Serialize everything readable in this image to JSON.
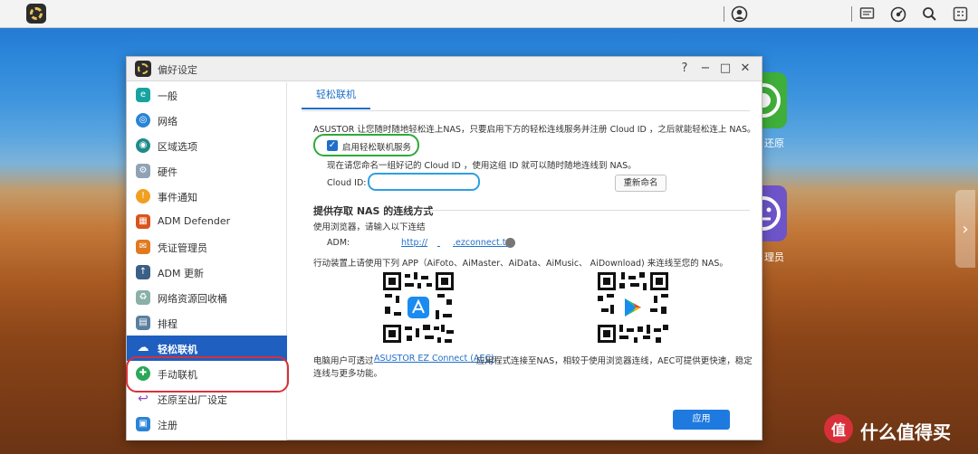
{
  "desktop": {
    "apps": [
      {
        "label": "还原",
        "color": "#3fae3a"
      },
      {
        "label": "理员",
        "color": "#6d54c9"
      }
    ]
  },
  "dialog": {
    "title": "偏好设定",
    "window_controls": {
      "help": "?",
      "minimize": "−",
      "maximize": "□",
      "close": "✕"
    }
  },
  "sidebar": {
    "items": [
      {
        "label": "一般",
        "icon": "general-icon",
        "color": "#17a3a0"
      },
      {
        "label": "网络",
        "icon": "globe-icon",
        "color": "#2a84d6"
      },
      {
        "label": "区域选项",
        "icon": "region-icon",
        "color": "#1f8a8a"
      },
      {
        "label": "硬件",
        "icon": "hardware-icon",
        "color": "#8fa3b5"
      },
      {
        "label": "事件通知",
        "icon": "notification-icon",
        "color": "#f0a020"
      },
      {
        "label": "ADM Defender",
        "icon": "firewall-icon",
        "color": "#d9541c"
      },
      {
        "label": "凭证管理员",
        "icon": "certificate-icon",
        "color": "#e07a20"
      },
      {
        "label": "ADM 更新",
        "icon": "update-icon",
        "color": "#3c5f86"
      },
      {
        "label": "网络资源回收桶",
        "icon": "recycle-bin-icon",
        "color": "#8ab0a8"
      },
      {
        "label": "排程",
        "icon": "schedule-icon",
        "color": "#5a7fa0"
      },
      {
        "label": "轻松联机",
        "icon": "cloud-connect-icon",
        "color": "#ffffff"
      },
      {
        "label": "手动联机",
        "icon": "manual-connect-icon",
        "color": "#2aa857"
      },
      {
        "label": "还原至出厂设定",
        "icon": "reset-icon",
        "color": "#8a4ac2"
      },
      {
        "label": "注册",
        "icon": "register-icon",
        "color": "#2a84d6"
      }
    ],
    "active_index": 10
  },
  "content": {
    "tab": "轻松联机",
    "intro": "ASUSTOR 让您随时随地轻松连上NAS，只要启用下方的轻松连线服务并注册 Cloud ID ，之后就能轻松连上 NAS。",
    "enable_label": "启用轻松联机服务",
    "enable_checked": true,
    "cloud_id_hint": "现在请您命名一组好记的 Cloud ID ，使用这组 ID 就可以随时随地连线到 NAS。",
    "cloud_id_label": "Cloud ID:",
    "cloud_id_value": "",
    "rename_button": "重新命名",
    "section_title": "提供存取 NAS 的连线方式",
    "browser_hint": "使用浏览器，请输入以下连结",
    "adm_label": "ADM:",
    "adm_link_prefix": "http://",
    "adm_link_suffix": ".ezconnect.to",
    "mobile_hint": "行动装置上请使用下列 APP（AiFoto、AiMaster、AiData、AiMusic、 AiDownload) 来连线至您的 NAS。",
    "qr_codes": [
      {
        "store": "app-store-icon",
        "color": "#1a8cf0"
      },
      {
        "store": "google-play-icon",
        "color": "#2ec26b"
      }
    ],
    "pc_hint_prefix": "电脑用户可透过",
    "aec_link": "ASUSTOR EZ Connect (AEC)",
    "pc_hint_suffix": "应用程式连接至NAS，相较于使用浏览器连线，AEC可提供更快速，稳定",
    "pc_hint_line2": "连线与更多功能。",
    "apply_button": "应用"
  },
  "watermark": {
    "text": "什么值得买"
  }
}
